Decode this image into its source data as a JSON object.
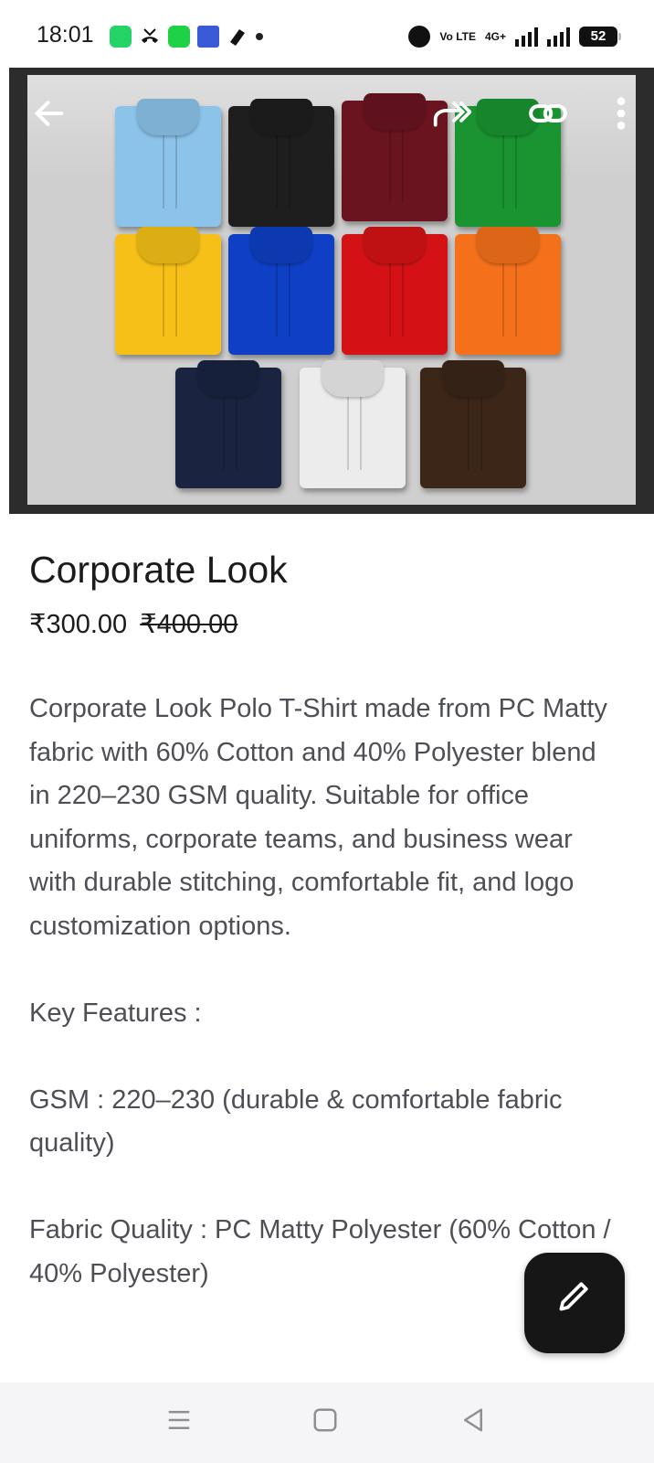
{
  "status_bar": {
    "time": "18:01",
    "battery": "52",
    "network": "4G+",
    "volte": "Vo LTE"
  },
  "hero": {
    "back_icon": "arrow-left-icon",
    "share_icon": "forward-share-icon",
    "link_icon": "link-icon",
    "more_icon": "more-vert-icon",
    "shirt_colors": [
      "#8cc3ea",
      "#1e1e1e",
      "#6a1420",
      "#1a9431",
      "#f6c018",
      "#0e3fc4",
      "#d41216",
      "#f4701a",
      "#1a2440",
      "#ececec",
      "#3b2618"
    ]
  },
  "product": {
    "title": "Corporate Look",
    "price": "₹300.00",
    "original_price": "₹400.00",
    "description": "Corporate Look Polo T-Shirt made from PC Matty fabric with 60% Cotton and 40% Polyester blend in 220–230 GSM quality. Suitable for office uniforms, corporate teams, and business wear with durable stitching, comfortable fit, and logo customization options.",
    "key_features_heading": "Key Features :",
    "feature_gsm": "GSM : 220–230 (durable & comfortable fabric quality)",
    "feature_fabric": "Fabric Quality : PC Matty Polyester (60% Cotton / 40% Polyester)"
  },
  "fab": {
    "icon": "pencil-edit-icon"
  },
  "nav": {
    "menu_icon": "menu-icon",
    "home_icon": "home-square-icon",
    "back_icon": "back-triangle-icon"
  }
}
